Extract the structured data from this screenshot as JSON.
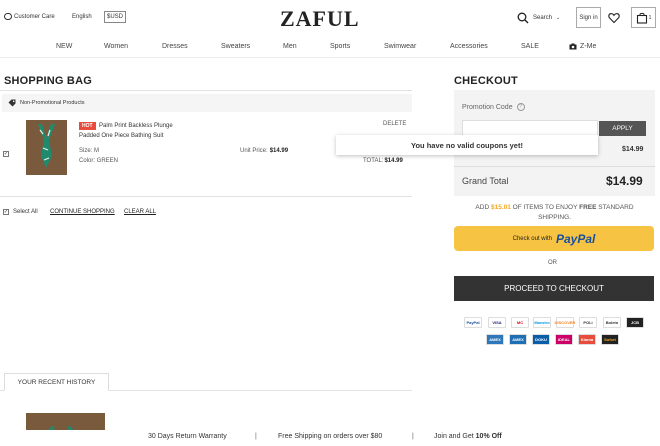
{
  "header": {
    "customer_care": "Customer Care",
    "language": "English",
    "currency": "$USD",
    "logo": "ZAFUL",
    "search_label": "Search",
    "signin": "Sign in",
    "bag_count": "1"
  },
  "nav": {
    "items": [
      "NEW",
      "Women",
      "Dresses",
      "Sweaters",
      "Men",
      "Sports",
      "Swimwear",
      "Accessories",
      "SALE",
      "Z-Me"
    ]
  },
  "bag": {
    "title": "SHOPPING BAG",
    "group_label": "Non-Promotional Products",
    "item": {
      "hot_badge": "HOT",
      "name_line1": "Palm Print Backless Plunge",
      "name_line2": "Padded One Piece Bathing Suit",
      "size": "Size: M",
      "color": "Color: GREEN",
      "unit_price_label": "Unit Price:",
      "unit_price": "$14.99",
      "delete": "DELETE",
      "total_label": "TOTAL:",
      "total": "$14.99"
    },
    "select_all": "Select All",
    "continue_shopping": "CONTINUE SHOPPING",
    "clear_all": "CLEAR ALL"
  },
  "recent": {
    "tab_label": "YOUR RECENT HISTORY"
  },
  "checkout": {
    "title": "CHECKOUT",
    "promo_label": "Promotion Code",
    "apply": "APPLY",
    "coupon_msg": "You have no valid coupons yet!",
    "subtotal": "$14.99",
    "grand_total_label": "Grand Total",
    "grand_total": "$14.99",
    "free_ship_prefix": "ADD",
    "free_ship_amount": "$15.01",
    "free_ship_mid": "OF ITEMS TO ENJOY",
    "free_ship_bold": "FREE",
    "free_ship_suffix": "STANDARD SHIPPING.",
    "paypal_prefix": "Check out with",
    "paypal_brand": "PayPal",
    "or": "OR",
    "proceed": "PROCEED TO CHECKOUT"
  },
  "payments_row1": [
    "PayPal",
    "VISA",
    "MC",
    "Maestro",
    "DISCOVER",
    "POLi",
    "Boleto",
    "JCB"
  ],
  "payments_row2": [
    "AMEX",
    "AMEX",
    "DOKU",
    "iDEAL",
    "Klarna",
    "Sofort"
  ],
  "footer": {
    "warranty": "30 Days Return Warranty",
    "shipping": "Free Shipping on orders over $80",
    "join_prefix": "Join and Get",
    "join_bold": "10% Off"
  },
  "colors": {
    "accent_orange": "#f5a623",
    "hot_red": "#e74c3c",
    "paypal_yellow": "#f7c342",
    "dark_button": "#333333"
  }
}
